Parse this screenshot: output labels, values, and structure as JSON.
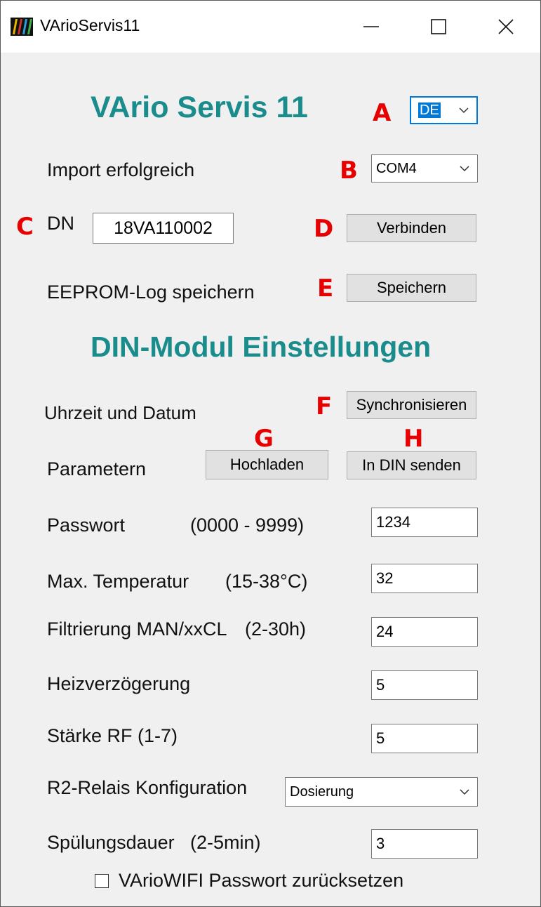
{
  "window": {
    "title": "VArioServis11",
    "minimize_icon": "minimize-icon",
    "maximize_icon": "maximize-icon",
    "close_icon": "close-icon"
  },
  "header": {
    "title": "VArio Servis 11",
    "language_value": "DE",
    "port_value": "COM4",
    "import_status": "Import erfolgreich"
  },
  "markers": {
    "a": "A",
    "b": "B",
    "c": "C",
    "d": "D",
    "e": "E",
    "f": "F",
    "g": "G",
    "h": "H"
  },
  "connection": {
    "dn_label": "DN",
    "dn_value": "18VA110002",
    "connect_button": "Verbinden"
  },
  "eeprom": {
    "label": "EEPROM-Log speichern",
    "save_button": "Speichern"
  },
  "din_section": {
    "title": "DIN-Modul Einstellungen",
    "time_date_label": "Uhrzeit und Datum",
    "sync_button": "Synchronisieren",
    "parameters_label": "Parametern",
    "upload_button": "Hochladen",
    "send_button": "In DIN senden"
  },
  "params": {
    "password_label": "Passwort",
    "password_range": "(0000 - 9999)",
    "password_value": "1234",
    "max_temp_label": "Max. Temperatur",
    "max_temp_range": "(15-38°C)",
    "max_temp_value": "32",
    "filter_label": "Filtrierung MAN/xxCL",
    "filter_range": "(2-30h)",
    "filter_value": "24",
    "heat_delay_label": "Heizverzögerung",
    "heat_delay_value": "5",
    "rf_label": "Stärke RF (1-7)",
    "rf_value": "5",
    "relay_label": "R2-Relais Konfiguration",
    "relay_value": "Dosierung",
    "flush_label": "Spülungsdauer",
    "flush_range": "(2-5min)",
    "flush_value": "3",
    "wifi_reset_label": "VArioWIFI Passwort zurücksetzen",
    "wifi_reset_checked": false
  },
  "colors": {
    "accent_heading": "#1a8c8c",
    "marker_red": "#e60000",
    "selection_blue": "#0078d7",
    "window_bg": "#f0f0f0"
  }
}
